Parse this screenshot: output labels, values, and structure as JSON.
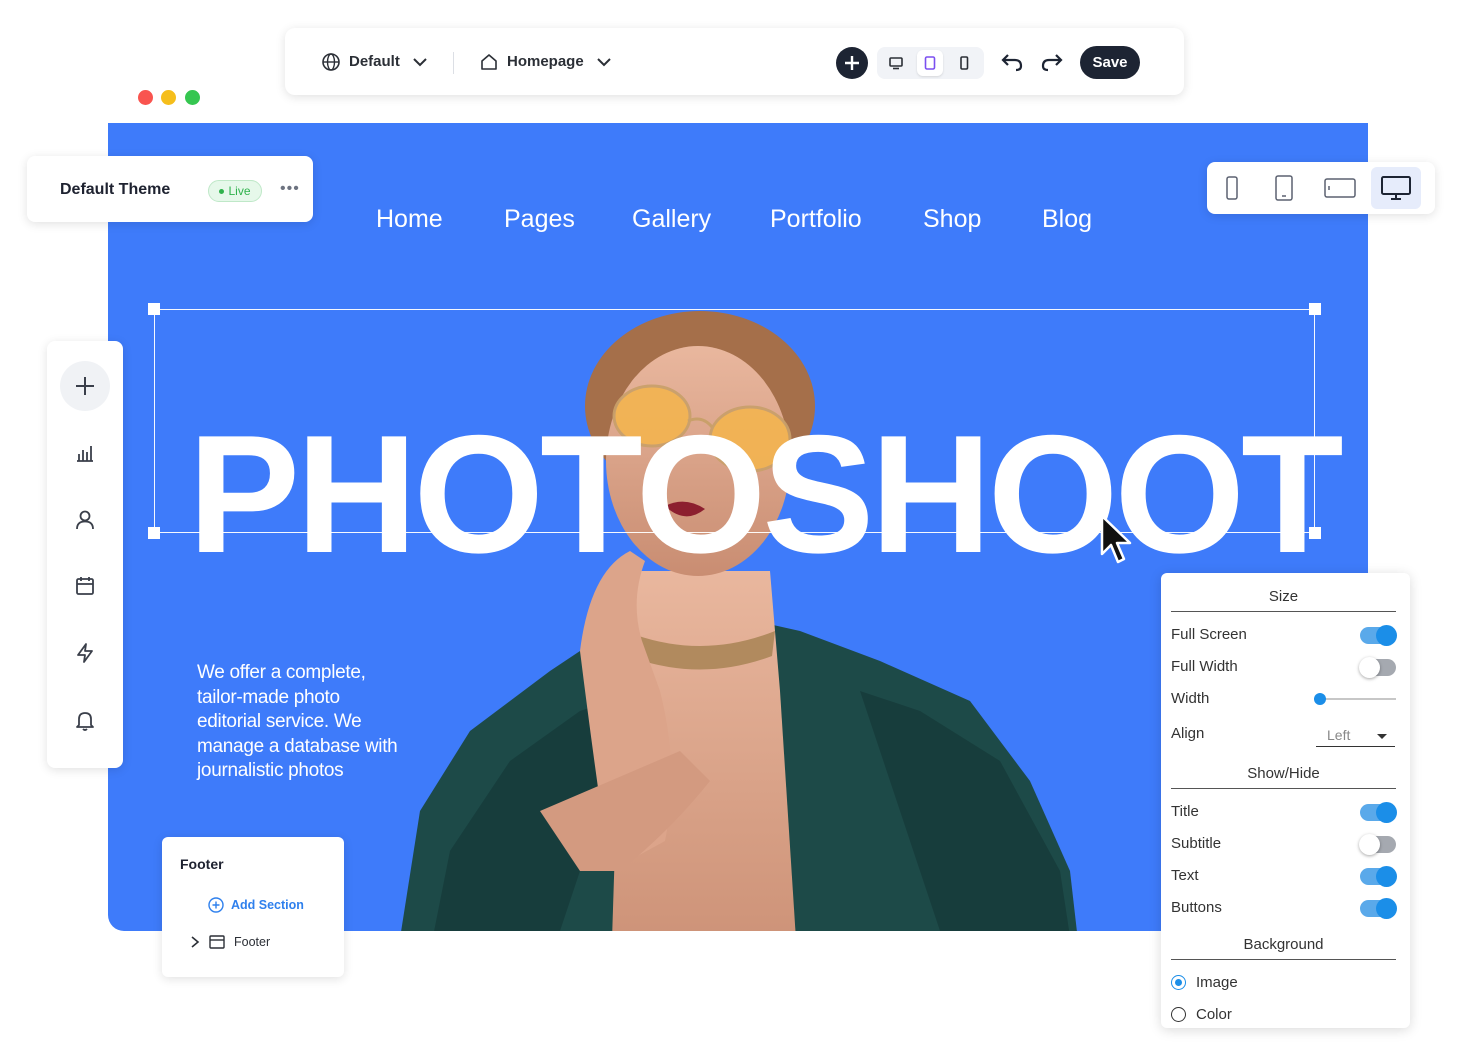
{
  "toolbar": {
    "theme_select": "Default",
    "page_select": "Homepage",
    "save_label": "Save"
  },
  "theme_card": {
    "name": "Default Theme",
    "status": "Live"
  },
  "site": {
    "nav": [
      "Home",
      "Pages",
      "Gallery",
      "Portfolio",
      "Shop",
      "Blog"
    ],
    "hero_title": "PHOTOSHOOT",
    "hero_text": "We offer a complete, tailor-made photo editorial service. We manage a database with journalistic photos"
  },
  "footer_panel": {
    "title": "Footer",
    "add_section": "Add Section",
    "item": "Footer"
  },
  "props_panel": {
    "size_heading": "Size",
    "full_screen": "Full Screen",
    "full_width": "Full Width",
    "width": "Width",
    "align": "Align",
    "align_value": "Left",
    "showhide_heading": "Show/Hide",
    "title": "Title",
    "subtitle": "Subtitle",
    "text": "Text",
    "buttons": "Buttons",
    "background_heading": "Background",
    "image": "Image",
    "color": "Color",
    "width_level": 0.05
  },
  "colors": {
    "brand_blue": "#3e7bfa",
    "dark": "#1d2433",
    "toggle_on": "#1b8ee8",
    "live_green": "#2fb24c"
  },
  "icons": {
    "sidebar": [
      "plus-icon",
      "chart-icon",
      "user-icon",
      "calendar-icon",
      "lightning-icon",
      "bell-icon"
    ],
    "devices": [
      "phone-icon",
      "tablet-icon",
      "tablet-landscape-icon",
      "desktop-icon"
    ]
  }
}
